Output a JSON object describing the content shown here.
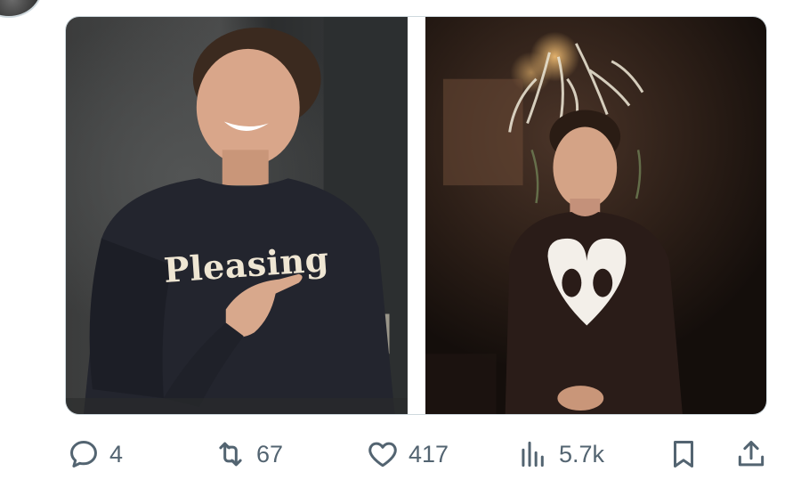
{
  "tweet": {
    "actions": {
      "reply": {
        "icon": "reply-icon",
        "count": "4"
      },
      "retweet": {
        "icon": "retweet-icon",
        "count": "67"
      },
      "like": {
        "icon": "heart-icon",
        "count": "417"
      },
      "views": {
        "icon": "views-icon",
        "count": "5.7k"
      },
      "bookmark": {
        "icon": "bookmark-icon"
      },
      "share": {
        "icon": "share-icon"
      }
    },
    "media": {
      "left_photo": {
        "sweater_text": "Pleasing"
      },
      "right_photo": {}
    }
  },
  "colors": {
    "action_gray": "#536471",
    "border": "#cfd9de"
  }
}
